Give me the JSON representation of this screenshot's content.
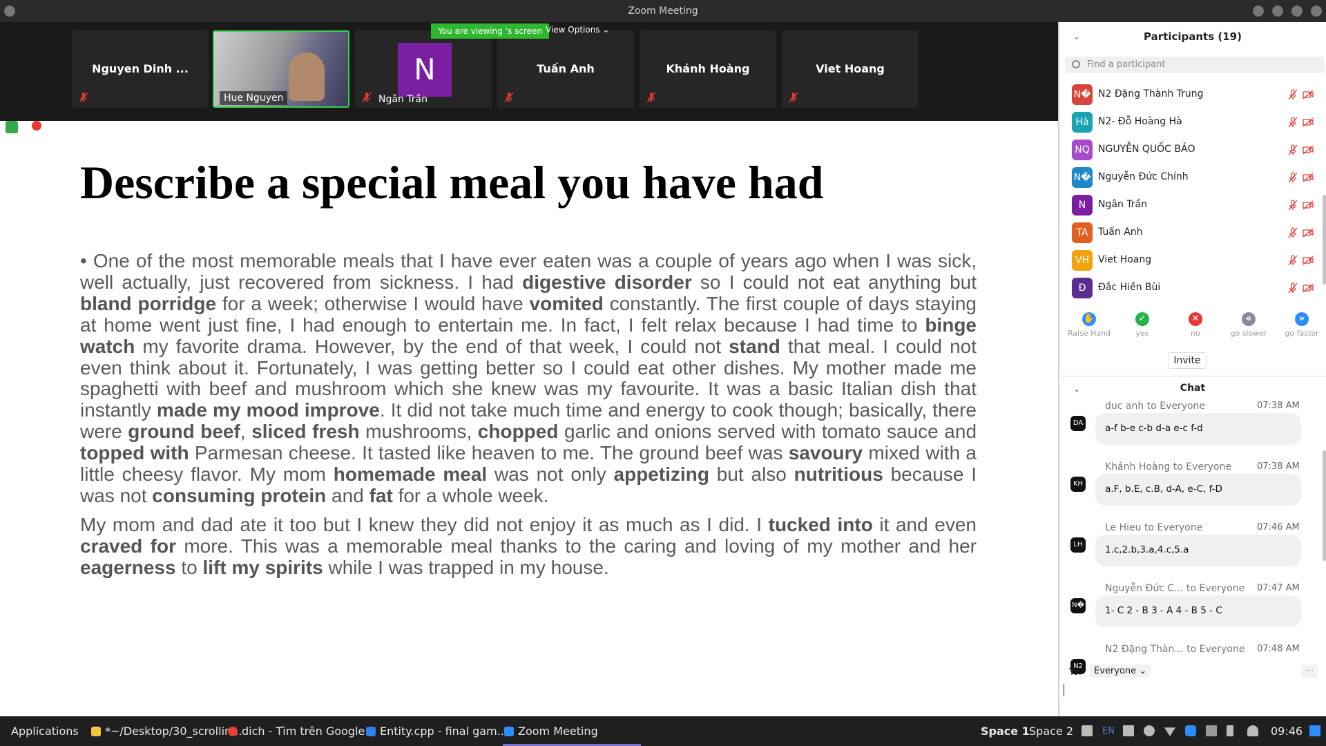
{
  "window": {
    "title": "Zoom Meeting"
  },
  "video_strip": {
    "tiles": [
      {
        "name": "Nguyen Dinh ..."
      },
      {
        "name": "Hue Nguyen"
      },
      {
        "name": "Ngân Trần",
        "avatar_letter": "N"
      },
      {
        "name": "Tuấn Anh"
      },
      {
        "name": "Khánh Hoàng"
      },
      {
        "name": "Viet Hoang"
      }
    ],
    "viewing_banner": "You are viewing 's screen",
    "view_options": "View Options"
  },
  "slide": {
    "title": "Describe a special meal you have had",
    "bullet": "•"
  },
  "participants": {
    "header": "Participants (19)",
    "search_placeholder": "Find a participant",
    "items": [
      {
        "initials": "N�",
        "name": "N2 Đặng Thành Trung",
        "color": "#d9443a"
      },
      {
        "initials": "Hà",
        "name": "N2- Đỗ Hoàng Hà",
        "color": "#1aa3b0"
      },
      {
        "initials": "NQ",
        "name": "NGUYỄN QUỐC BẢO",
        "color": "#a64bc9"
      },
      {
        "initials": "N�",
        "name": "Nguyễn Đức Chính",
        "color": "#1e88c8"
      },
      {
        "initials": "N",
        "name": "Ngân Trần",
        "color": "#7b1fa2"
      },
      {
        "initials": "TA",
        "name": "Tuấn Anh",
        "color": "#e0601f"
      },
      {
        "initials": "VH",
        "name": "Viet Hoang",
        "color": "#f2a20c"
      },
      {
        "initials": "Đ",
        "name": "Đắc Hiền Bùi",
        "color": "#5b2d90"
      }
    ],
    "actions": [
      {
        "label": "Raise Hand",
        "color": "#2d8cff",
        "glyph": "✋"
      },
      {
        "label": "yes",
        "color": "#23b24b",
        "glyph": "✓"
      },
      {
        "label": "no",
        "color": "#e53935",
        "glyph": "✕"
      },
      {
        "label": "go slower",
        "color": "#8a8a9a",
        "glyph": "«"
      },
      {
        "label": "go faster",
        "color": "#2d8cff",
        "glyph": "»"
      }
    ],
    "invite_label": "Invite"
  },
  "chat": {
    "header": "Chat",
    "messages": [
      {
        "avatar": "DA",
        "from": "duc anh to Everyone",
        "time": "07:38 AM",
        "text": "a-f b-e c-b d-a e-c f-d"
      },
      {
        "avatar": "KH",
        "from": "Khánh Hoàng to Everyone",
        "time": "07:38 AM",
        "text": "a.F, b.E, c.B, d-A, e-C, f-D"
      },
      {
        "avatar": "LH",
        "from": "Le Hieu to Everyone",
        "time": "07:46 AM",
        "text": "1.c,2.b,3.a,4.c,5.a"
      },
      {
        "avatar": "N�",
        "from": "Nguyễn Đức C... to Everyone",
        "time": "07:47 AM",
        "text": "1- C 2 - B 3 - A 4 - B 5 - C"
      },
      {
        "avatar": "N2",
        "from": "N2 Đặng Thàn... to Everyone",
        "time": "07:48 AM",
        "text": ""
      }
    ],
    "to_label": "To:",
    "to_value": "Everyone",
    "more_label": "···"
  },
  "taskbar": {
    "applications": "Applications",
    "items": [
      {
        "label": "*~/Desktop/30_scrollin...",
        "color": "#f5c542"
      },
      {
        "label": "dich - Tìm trên Google...",
        "color": "#e34234"
      },
      {
        "label": "Entity.cpp - final gam...",
        "color": "#2f80ed"
      },
      {
        "label": "Zoom Meeting",
        "color": "#2d8cff"
      }
    ],
    "space1": "Space 1",
    "space2": "Space 2",
    "lang": "EN",
    "clock": "09:46"
  }
}
